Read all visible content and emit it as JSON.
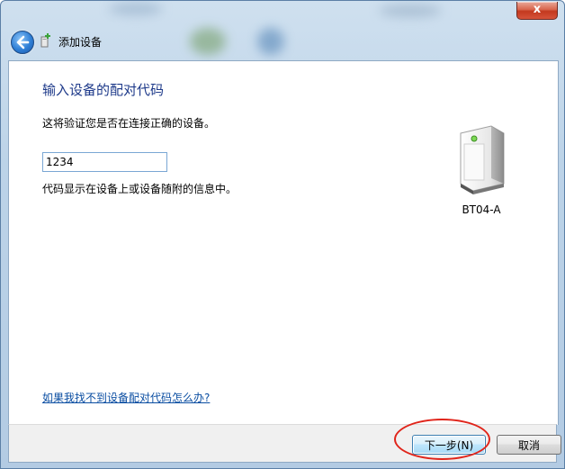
{
  "window": {
    "title": "添加设备",
    "close_label": "x"
  },
  "main": {
    "heading": "输入设备的配对代码",
    "description": "这将验证您是否在连接正确的设备。",
    "code_value": "1234",
    "hint": "代码显示在设备上或设备随附的信息中。",
    "help_link": "如果我找不到设备配对代码怎么办?"
  },
  "device": {
    "name": "BT04-A",
    "icon": "device-tower-icon"
  },
  "footer": {
    "next_label": "下一步(N)",
    "cancel_label": "取消"
  },
  "colors": {
    "heading": "#1e3a8a",
    "link": "#0b4ea2",
    "highlight_circle": "#e0241a"
  }
}
